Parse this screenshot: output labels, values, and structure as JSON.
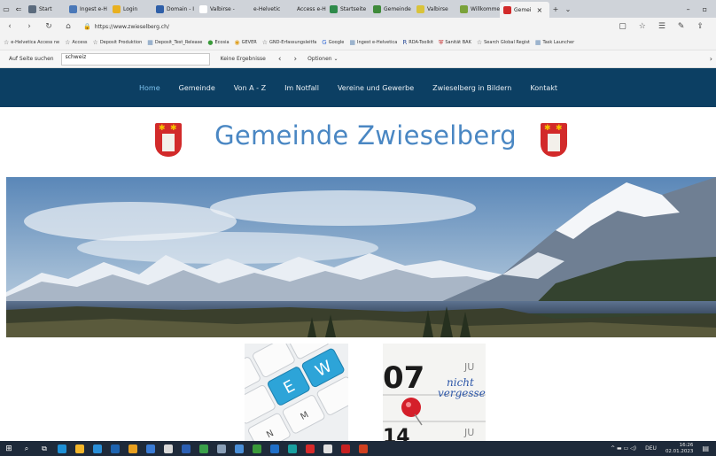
{
  "browser": {
    "tabs": [
      {
        "label": "Start",
        "color": "#5b6b7d"
      },
      {
        "label": "Ingest e-H",
        "color": "#4a78b8"
      },
      {
        "label": "Login",
        "color": "#e8b020"
      },
      {
        "label": "Domain - I",
        "color": "#2f5fa8"
      },
      {
        "label": "Valbirse -",
        "color": "#ffffff"
      },
      {
        "label": "e-Helvetic",
        "color": "#cfd3d9"
      },
      {
        "label": "Access e-H",
        "color": "#cfd3d9"
      },
      {
        "label": "Startseite",
        "color": "#2e8a4a"
      },
      {
        "label": "Gemeinde",
        "color": "#3f8a3a"
      },
      {
        "label": "Valbirse",
        "color": "#d9c33a"
      },
      {
        "label": "Willkommen",
        "color": "#7aa23a"
      },
      {
        "label": "Gemei",
        "color": "#d22a2a",
        "active": true
      }
    ],
    "url": "https://www.zwieselberg.ch/",
    "favorites": [
      {
        "label": "e-Helvetica Access ne",
        "icon": "star-icon"
      },
      {
        "label": "Access",
        "icon": "star-icon"
      },
      {
        "label": "Deposit Produktion",
        "icon": "star-icon"
      },
      {
        "label": "Deposit_Test_Release",
        "icon": "folder-icon"
      },
      {
        "label": "Ecosia",
        "icon": "ecosia-icon"
      },
      {
        "label": "GEVER",
        "icon": "gever-icon"
      },
      {
        "label": "GND-Erfassungsleitfa",
        "icon": "star-icon"
      },
      {
        "label": "Google",
        "icon": "google-icon"
      },
      {
        "label": "Ingest e-Helvetica",
        "icon": "folder-icon"
      },
      {
        "label": "RDA-Toolkit",
        "icon": "rda-icon"
      },
      {
        "label": "Sanität BAK",
        "icon": "shield-icon"
      },
      {
        "label": "Search Global Regist",
        "icon": "star-icon"
      },
      {
        "label": "Task Launcher",
        "icon": "folder-icon"
      }
    ],
    "find": {
      "label": "Auf Seite suchen",
      "value": "schweiz",
      "result": "Keine Ergebnisse",
      "options": "Optionen"
    }
  },
  "site": {
    "nav": [
      "Home",
      "Gemeinde",
      "Von A - Z",
      "Im Notfall",
      "Vereine und Gewerbe",
      "Zwieselberg in Bildern",
      "Kontakt"
    ],
    "title": "Gemeinde Zwieselberg",
    "tile2": {
      "day": "07",
      "text1": "nicht",
      "text2": "vergesse",
      "ju_top": "JU",
      "ju_bottom": "JU",
      "day2": "14"
    },
    "tile1": {
      "keys": [
        "E",
        "W"
      ],
      "small": [
        "M",
        "N"
      ]
    }
  },
  "taskbar": {
    "lang": "DEU",
    "time": "16:26",
    "date": "02.01.2023"
  },
  "colors": {
    "navbar": "#0c3f63",
    "title": "#4a87c3",
    "crest": "#d22a2a",
    "active_nav": "#7dc2ee"
  }
}
